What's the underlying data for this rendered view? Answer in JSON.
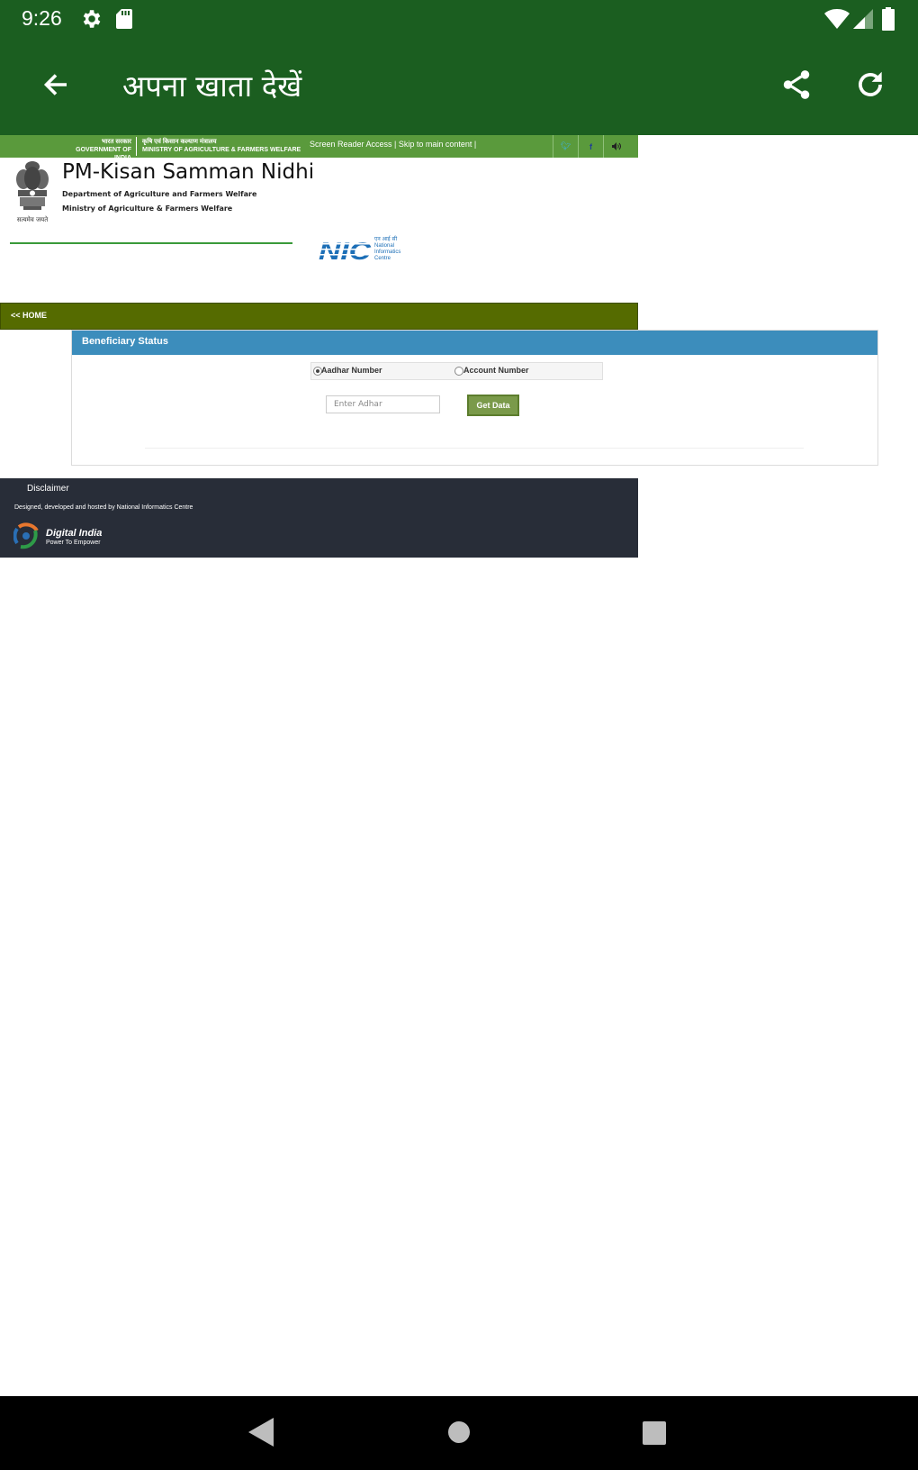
{
  "status_bar": {
    "time": "9:26"
  },
  "app_bar": {
    "title": "अपना खाता देखें"
  },
  "site": {
    "gov_hindi": "भारत सरकार",
    "gov_english": "GOVERNMENT OF INDIA",
    "ministry_hindi": "कृषि एवं किसान कल्याण मंत्रालय",
    "ministry_english": "MINISTRY OF AGRICULTURE & FARMERS WELFARE",
    "access_links": "Screen Reader Access | Skip to main content |",
    "emblem_motto": "सत्यमेव जयते",
    "title": "PM-Kisan Samman Nidhi",
    "subtitle1": "Department of Agriculture and Farmers Welfare",
    "subtitle2": "Ministry of Agriculture & Farmers Welfare",
    "nic_logo": {
      "text": "NIC",
      "hindi": "एन आई सी",
      "line1": "National",
      "line2": "Informatics",
      "line3": "Centre"
    },
    "home_link": "<< HOME"
  },
  "panel": {
    "title": "Beneficiary Status",
    "radio_options": [
      {
        "label": "Aadhar Number",
        "checked": true
      },
      {
        "label": "Account Number",
        "checked": false
      }
    ],
    "input": {
      "placeholder": "Enter Adhar",
      "value": ""
    },
    "button_label": "Get Data"
  },
  "footer": {
    "disclaimer": "Disclaimer",
    "credit": "Designed, developed and hosted by National Informatics Centre",
    "logo_name": "Digital India",
    "logo_tagline": "Power To Empower"
  },
  "colors": {
    "app_bar": "#1b5e20",
    "gov_strip": "#5a9a3c",
    "home_bar": "#556b00",
    "panel_head": "#3c8dbc",
    "button": "#7a9a4a",
    "footer": "#282d38"
  },
  "icons": {
    "status": [
      "gear-icon",
      "sd-card-icon",
      "wifi-icon",
      "signal-icon",
      "battery-icon"
    ],
    "app_bar": [
      "back-arrow-icon",
      "share-icon",
      "refresh-icon"
    ],
    "social": [
      "twitter-icon",
      "facebook-icon",
      "audio-icon"
    ],
    "nav": [
      "nav-back-icon",
      "nav-home-icon",
      "nav-recents-icon"
    ]
  }
}
